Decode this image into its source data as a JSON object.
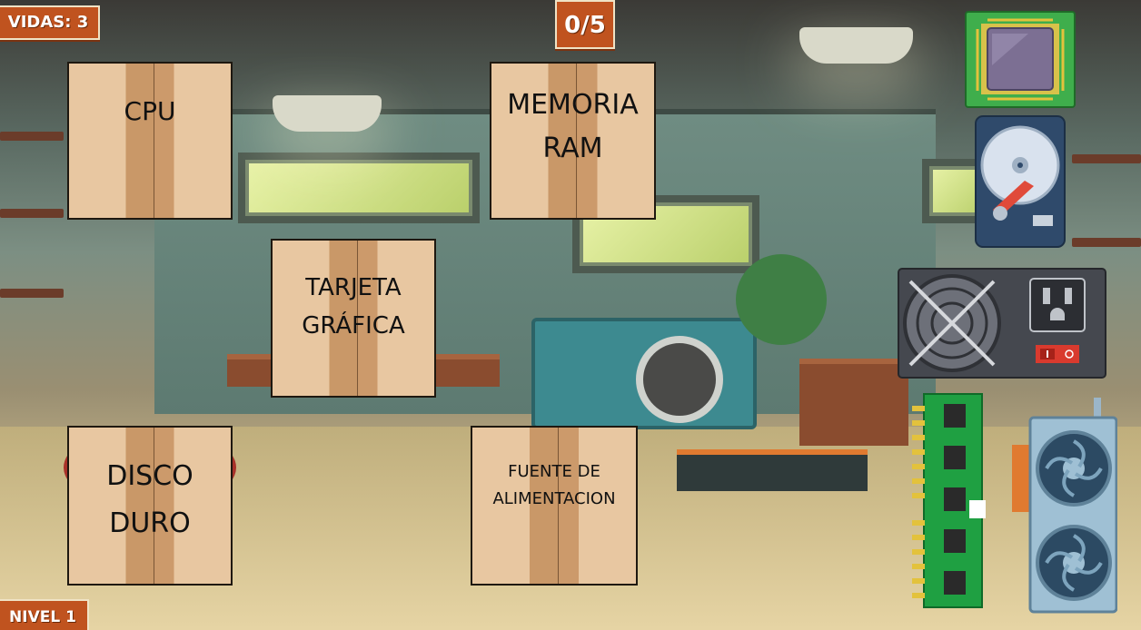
{
  "hud": {
    "lives": "VIDAS: 3",
    "score": "0/5",
    "level": "NIVEL 1"
  },
  "drop_targets": [
    {
      "label": "CPU"
    },
    {
      "label": "MEMORIA\nRAM"
    },
    {
      "label": "TARJETA\nGRÁFICA"
    },
    {
      "label": "DISCO\nDURO"
    },
    {
      "label": "FUENTE DE\nALIMENTACION"
    }
  ],
  "components": [
    {
      "name": "cpu-chip-icon"
    },
    {
      "name": "hard-drive-icon"
    },
    {
      "name": "power-supply-icon"
    },
    {
      "name": "ram-stick-icon"
    },
    {
      "name": "graphics-card-icon"
    }
  ],
  "colors": {
    "hud_orange": "#c0531f",
    "box_light": "#e8c7a1",
    "box_tape": "#c99868"
  }
}
